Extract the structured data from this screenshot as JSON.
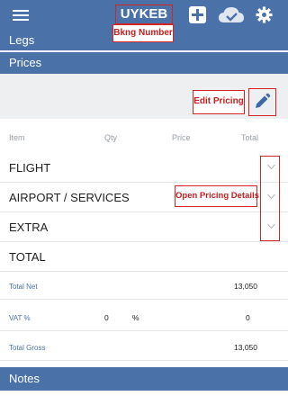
{
  "header": {
    "booking_number": "UYKEB",
    "icons": [
      "menu-icon",
      "add-icon",
      "cloud-sync-icon",
      "gear-icon"
    ]
  },
  "callouts": {
    "booking": "Bkng Number",
    "edit": "Edit Pricing",
    "open": "Open Pricing Details"
  },
  "sections": {
    "legs": "Legs",
    "prices": "Prices",
    "notes": "Notes"
  },
  "table": {
    "columns": [
      "Item",
      "Qty",
      "Price",
      "Total"
    ],
    "rows": [
      {
        "label": "FLIGHT"
      },
      {
        "label": "AIRPORT / SERVICES"
      },
      {
        "label": "EXTRA"
      },
      {
        "label": "TOTAL"
      }
    ]
  },
  "summary": {
    "total_net": {
      "label": "Total Net",
      "value": "13,050"
    },
    "vat": {
      "label": "VAT %",
      "qty": "0",
      "unit": "%",
      "value": "0"
    },
    "total_gross": {
      "label": "Total Gross",
      "value": "13,050"
    }
  },
  "colors": {
    "header_blue": "#4a72a8",
    "callout_red": "#d42525",
    "edit_strip": "#eeeff1"
  }
}
